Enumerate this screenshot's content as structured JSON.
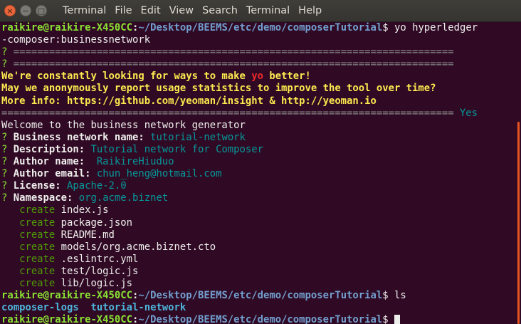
{
  "window": {
    "close_glyph": "×",
    "minimize_glyph": "−",
    "maximize_glyph": "□",
    "menu": [
      "Terminal",
      "File",
      "Edit",
      "View",
      "Search",
      "Terminal",
      "Help"
    ]
  },
  "terminal": {
    "prompt_user": "raikire@raikire-X450CC",
    "prompt_sep": ":",
    "prompt_path": "~/Desktop/BEEMS/etc/demo/composerTutorial",
    "prompt_dollar": "$",
    "cmd1_line1": " yo hyperledger",
    "cmd1_line2": "-composer:businessnetwork",
    "q_mark": "?",
    "eq_line": " ==========================================================================",
    "msg1_pre": "We're constantly looking for ways to make ",
    "msg1_yo": "yo",
    "msg1_post": " better!",
    "msg2": "May we anonymously report usage statistics to improve the tool over time?",
    "msg3": "More info: https://github.com/yeoman/insight & http://yeoman.io",
    "eq_line2": "============================================================================",
    "eq_answer": " Yes",
    "welcome": "Welcome to the business network generator",
    "fields": [
      {
        "label": " Business network name:",
        "value": " tutorial-network"
      },
      {
        "label": " Description:",
        "value": " Tutorial network for Composer"
      },
      {
        "label": " Author name:",
        "value": "  RaikireHiuduo"
      },
      {
        "label": " Author email:",
        "value": " chun_heng@hotmail.com"
      },
      {
        "label": " License:",
        "value": " Apache-2.0"
      },
      {
        "label": " Namespace:",
        "value": " org.acme.biznet"
      }
    ],
    "create_word": "   create",
    "created_files": [
      " index.js",
      " package.json",
      " README.md",
      " models/org.acme.biznet.cto",
      " .eslintrc.yml",
      " test/logic.js",
      " lib/logic.js"
    ],
    "cmd2": " ls",
    "ls_dir1": "composer-logs",
    "ls_gap": "  ",
    "ls_dir2": "tutorial-network",
    "scrollbar_color": "#e95420"
  }
}
